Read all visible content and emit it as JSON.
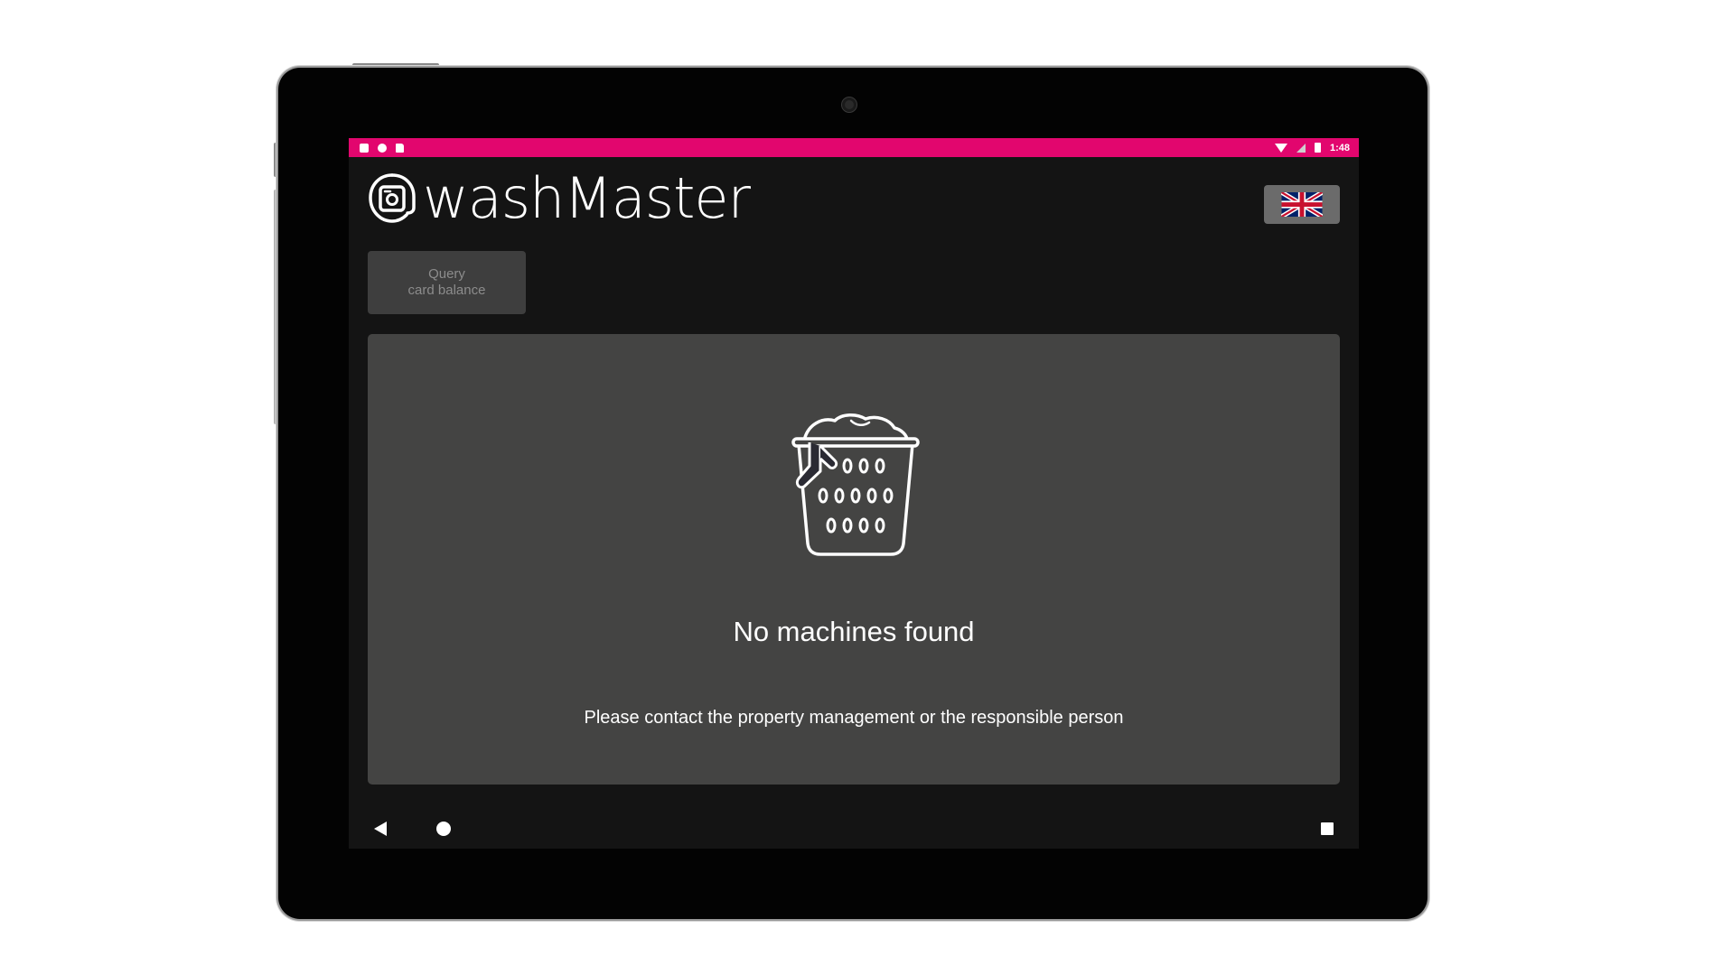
{
  "status_bar": {
    "time": "1:48",
    "left_icons": [
      "notification-icon",
      "sync-icon",
      "sd-card-icon"
    ],
    "right_icons": [
      "wifi-icon",
      "signal-icon",
      "battery-icon"
    ],
    "color": "#e2066e"
  },
  "header": {
    "brand": "washMaster",
    "language": {
      "selected": "English",
      "flag_icon": "uk-flag-icon"
    }
  },
  "actions": {
    "query_line1": "Query",
    "query_line2": "card balance"
  },
  "empty_state": {
    "icon": "laundry-basket-icon",
    "title": "No machines found",
    "message": "Please contact the property management or the responsible person"
  },
  "nav_bar": {
    "buttons": [
      "back-icon",
      "home-icon",
      "recents-icon"
    ]
  },
  "colors": {
    "accent": "#e2066e",
    "screen_background": "#141414",
    "panel_background": "#444443",
    "button_background": "#3e3e3e",
    "language_button_background": "#6b6b6b"
  }
}
